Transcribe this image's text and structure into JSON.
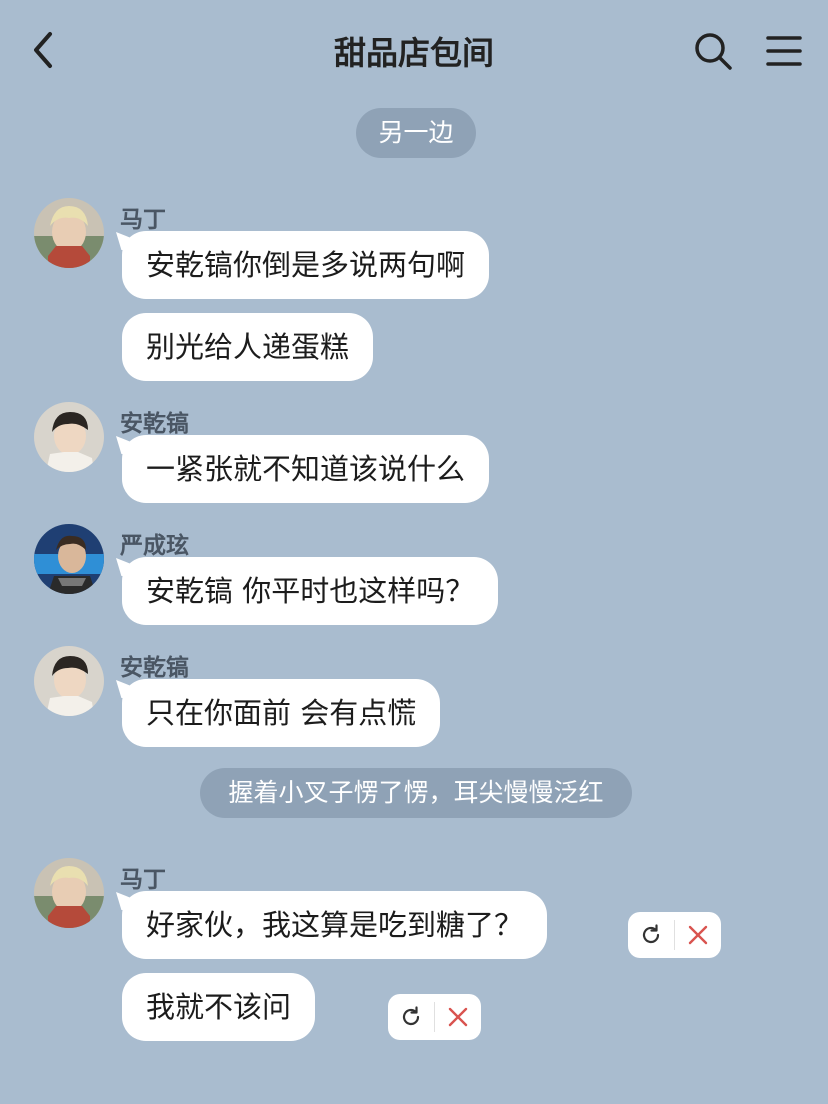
{
  "header": {
    "title": "甜品店包间",
    "back_icon": "chevron-left-icon",
    "search_icon": "search-icon",
    "menu_icon": "hamburger-menu-icon"
  },
  "system_notes": [
    "另一边",
    "握着小叉子愣了愣，耳尖慢慢泛红"
  ],
  "messages": [
    {
      "sender": "马丁",
      "bubbles": [
        "安乾镐你倒是多说两句啊",
        "别光给人递蛋糕"
      ]
    },
    {
      "sender": "安乾镐",
      "bubbles": [
        "一紧张就不知道该说什么"
      ]
    },
    {
      "sender": "严成玹",
      "bubbles": [
        "安乾镐 你平时也这样吗？"
      ]
    },
    {
      "sender": "安乾镐",
      "bubbles": [
        "只在你面前 会有点慌"
      ]
    },
    {
      "sender": "马丁",
      "bubbles": [
        "好家伙，我这算是吃到糖了？",
        "我就不该问"
      ]
    }
  ],
  "colors": {
    "background": "#a9bccf",
    "pill": "#8fa2b6",
    "bubble": "#ffffff",
    "delete_x": "#d9534f"
  },
  "action_icons": [
    "refresh-icon",
    "close-icon"
  ]
}
